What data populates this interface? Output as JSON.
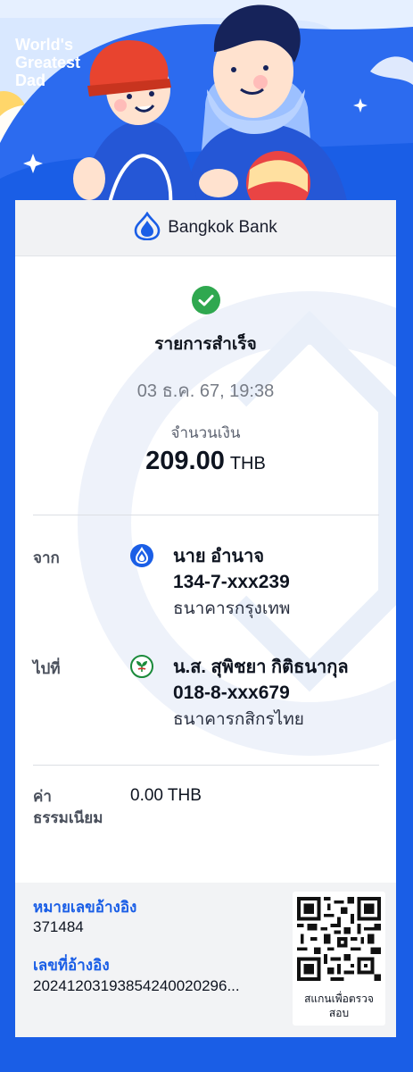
{
  "hero": {
    "title_lines": [
      "World's",
      "Greatest",
      "Dad"
    ]
  },
  "header": {
    "bank_name": "Bangkok Bank"
  },
  "status": {
    "title": "รายการสำเร็จ",
    "datetime": "03 ธ.ค. 67, 19:38",
    "amount_label": "จำนวนเงิน",
    "amount": "209.00",
    "currency": "THB"
  },
  "from": {
    "label": "จาก",
    "name": "นาย อำนาจ",
    "account": "134-7-xxx239",
    "bank": "ธนาคารกรุงเทพ",
    "icon": "bangkok-bank-logo-icon"
  },
  "to": {
    "label": "ไปที่",
    "name": "น.ส. สุพิชยา กิติธนากุล",
    "account": "018-8-xxx679",
    "bank": "ธนาคารกสิกรไทย",
    "icon": "kasikorn-bank-logo-icon"
  },
  "fee": {
    "label_line1": "ค่า",
    "label_line2": "ธรรมเนียม",
    "value": "0.00 THB"
  },
  "reference": {
    "ref_no_label": "หมายเลขอ้างอิง",
    "ref_no": "371484",
    "ref_id_label": "เลขที่อ้างอิง",
    "ref_id": "20241203193854240020296...",
    "qr_caption_line1": "สแกนเพื่อตรวจ",
    "qr_caption_line2": "สอบ"
  },
  "colors": {
    "brand_blue": "#1a5ee6",
    "success_green": "#2fa84f",
    "kbank_green": "#1a8a3a"
  }
}
